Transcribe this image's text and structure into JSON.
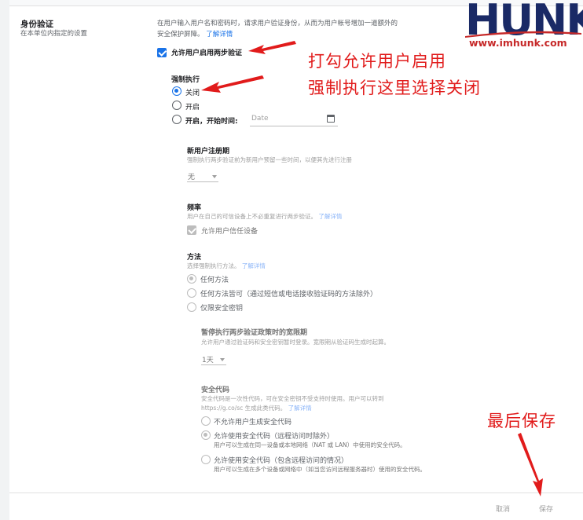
{
  "colors": {
    "accent": "#1a73e8",
    "annotation": "#e11b1b",
    "brand_navy": "#1a2a66",
    "brand_red": "#c62828"
  },
  "section": {
    "title": "身份验证",
    "subtitle": "在本单位内指定的设置",
    "description": "在用户输入用户名和密码时，请求用户验证身份，从而为用户帐号增加一道额外的安全保护屏障。",
    "learn_more": "了解详情"
  },
  "allow_2sv": {
    "label": "允许用户启用两步验证",
    "checked": true
  },
  "enforcement": {
    "title": "强制执行",
    "options": [
      {
        "label": "关闭",
        "selected": true
      },
      {
        "label": "开启",
        "selected": false
      },
      {
        "label": "开启，开始时间:",
        "selected": false
      }
    ],
    "date_placeholder": "Date"
  },
  "new_user_period": {
    "title": "新用户注册期",
    "description": "强制执行两步验证前为新用户预留一些时间，以便其先进行注册",
    "value": "无"
  },
  "frequency": {
    "title": "频率",
    "description": "用户在自己的可信设备上不必重复进行两步验证。",
    "learn_more": "了解详情",
    "trust_device_label": "允许用户信任设备"
  },
  "methods": {
    "title": "方法",
    "description": "选择强制执行方法。",
    "learn_more": "了解详情",
    "options": [
      {
        "label": "任何方法",
        "selected": true
      },
      {
        "label": "任何方法皆可（通过短信或电话接收验证码的方法除外）",
        "selected": false
      },
      {
        "label": "仅限安全密钥",
        "selected": false
      }
    ]
  },
  "grace_period": {
    "title": "暂停执行两步验证政策时的宽限期",
    "description": "允许用户通过验证码和安全密钥暂时登录。宽限期从验证码生成时起算。",
    "value": "1天"
  },
  "security_codes": {
    "title": "安全代码",
    "description_line1": "安全代码是一次性代码，可在安全密钥不受支持时使用。用户可以转到",
    "description_line2": "https://g.co/sc 生成此类代码。",
    "learn_more": "了解详情",
    "options": [
      {
        "label": "不允许用户生成安全代码",
        "detail": "",
        "selected": false
      },
      {
        "label": "允许使用安全代码（远程访问时除外）",
        "detail": "用户可以生成在同一设备或本地网络（NAT 或 LAN）中使用的安全代码。",
        "selected": true
      },
      {
        "label": "允许使用安全代码（包含远程访问的情况）",
        "detail": "用户可以生成在多个设备或网络中（如当您访问远程服务器时）使用的安全代码。",
        "selected": false
      }
    ]
  },
  "footer": {
    "cancel": "取消",
    "save": "保存"
  },
  "annotations": {
    "line1": "打勾允许用户启用",
    "line2": "强制执行这里选择关闭",
    "save_note": "最后保存"
  },
  "logo": {
    "text": "HUNK",
    "url": "www.imhunk.com"
  }
}
